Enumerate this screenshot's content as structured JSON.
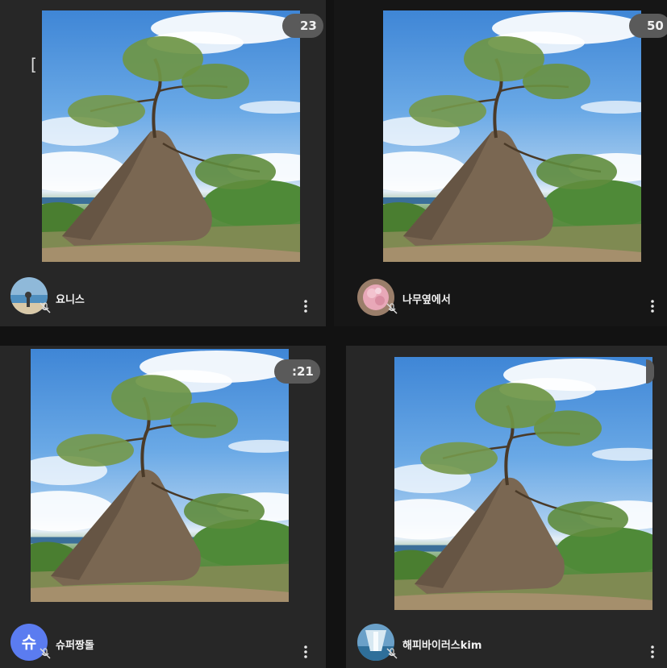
{
  "participants": [
    {
      "name": "요니스",
      "badge": "23",
      "avatar": "photo-beach-avatar"
    },
    {
      "name": "나무옆에서",
      "badge": "50",
      "avatar": "photo-flower-avatar"
    },
    {
      "name": "슈퍼짱돌",
      "badge": ":21",
      "avatar_letter": "슈",
      "avatar_color": "#5b7cf0"
    },
    {
      "name": "해피바이러스kim",
      "badge": "",
      "avatar": "photo-waterfall-avatar"
    }
  ],
  "stray_glyph": "[",
  "icons": {
    "mic_muted": "mic-muted-icon",
    "more": "more-vertical-icon"
  },
  "colors": {
    "tile_bg": "#272727",
    "page_bg": "#121212",
    "badge_bg": "#5a5a5a"
  }
}
